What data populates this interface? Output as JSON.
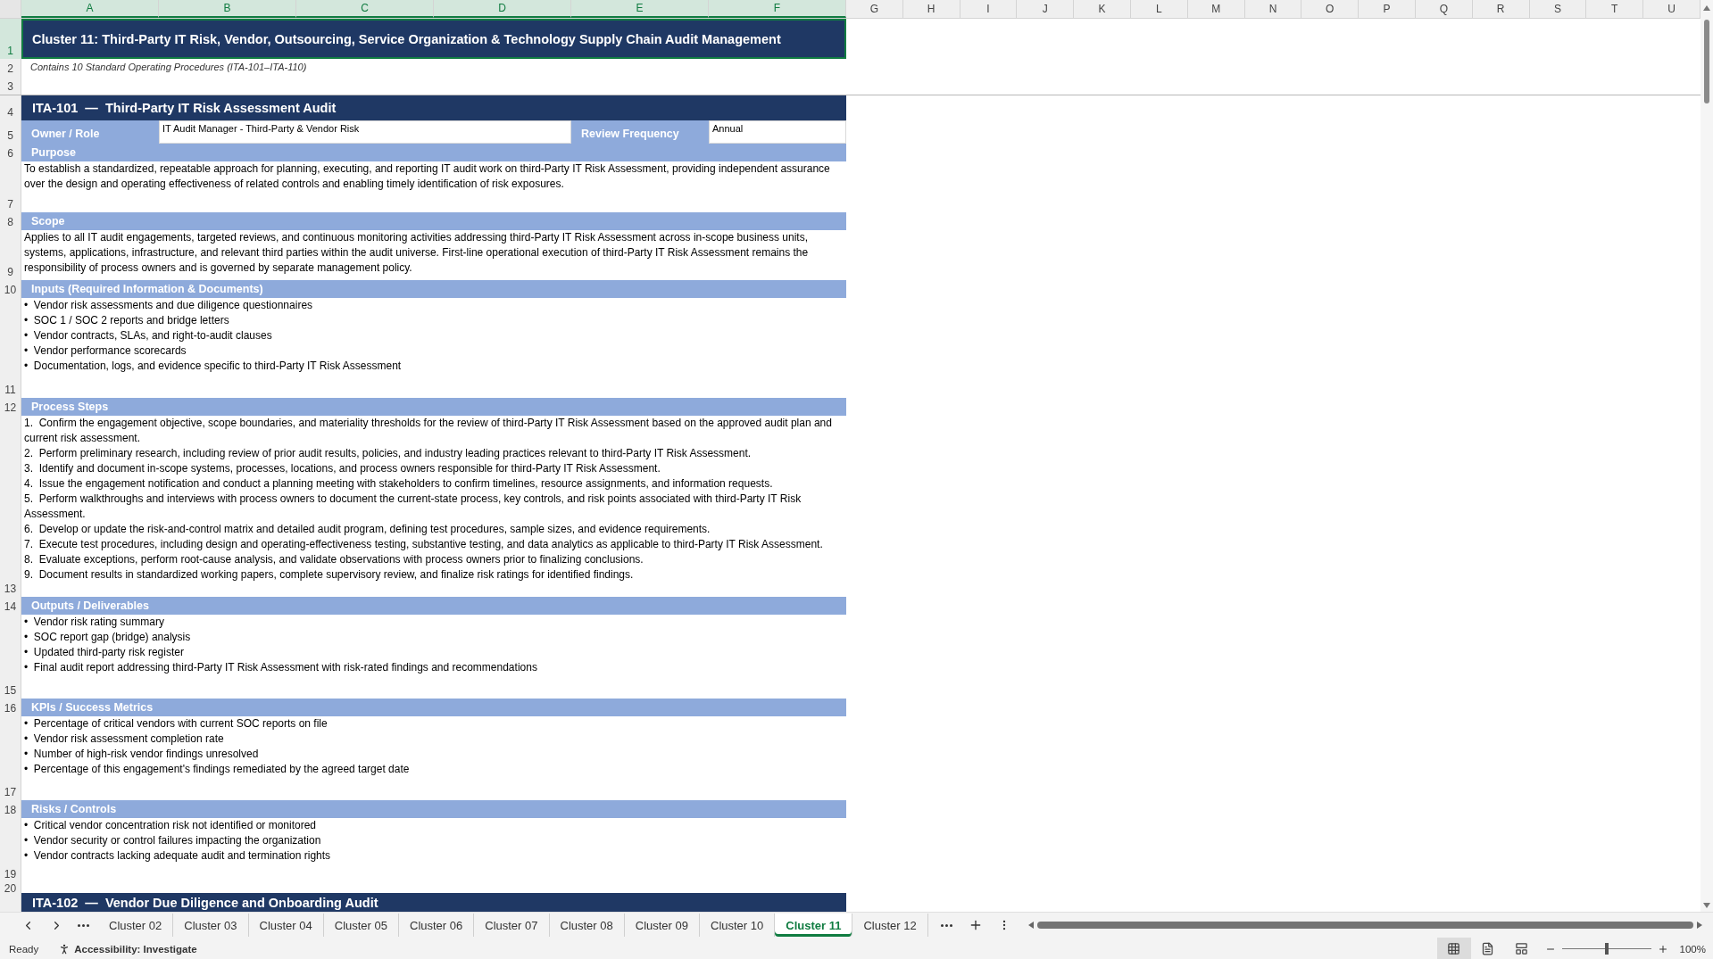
{
  "columns": [
    {
      "label": "A",
      "selected": true
    },
    {
      "label": "B",
      "selected": true
    },
    {
      "label": "C",
      "selected": true
    },
    {
      "label": "D",
      "selected": true
    },
    {
      "label": "E",
      "selected": true
    },
    {
      "label": "F",
      "selected": true
    },
    {
      "label": "G",
      "selected": false
    },
    {
      "label": "H",
      "selected": false
    },
    {
      "label": "I",
      "selected": false
    },
    {
      "label": "J",
      "selected": false
    },
    {
      "label": "K",
      "selected": false
    },
    {
      "label": "L",
      "selected": false
    },
    {
      "label": "M",
      "selected": false
    },
    {
      "label": "N",
      "selected": false
    },
    {
      "label": "O",
      "selected": false
    },
    {
      "label": "P",
      "selected": false
    },
    {
      "label": "Q",
      "selected": false
    },
    {
      "label": "R",
      "selected": false
    },
    {
      "label": "S",
      "selected": false
    },
    {
      "label": "T",
      "selected": false
    },
    {
      "label": "U",
      "selected": false
    }
  ],
  "rows": [
    {
      "number": "1",
      "selected": true,
      "kind": "title",
      "text": "Cluster 11: Third-Party IT Risk, Vendor, Outsourcing, Service Organization & Technology Supply Chain Audit Management"
    },
    {
      "number": "2",
      "selected": false,
      "kind": "note",
      "text": "Contains 10 Standard Operating Procedures (ITA-101–ITA-110)"
    },
    {
      "number": "3",
      "selected": false,
      "kind": "blank"
    },
    {
      "number": "4",
      "selected": false,
      "kind": "sop_header",
      "text": "ITA-101  —  Third-Party IT Risk Assessment Audit"
    },
    {
      "number": "5",
      "selected": false,
      "kind": "owner",
      "owner_label": "Owner / Role",
      "owner": "IT Audit Manager - Third-Party & Vendor Risk",
      "frequency_label": "Review Frequency",
      "frequency": "Annual"
    },
    {
      "number": "6",
      "selected": false,
      "kind": "section",
      "text": "Purpose"
    },
    {
      "number": "7",
      "selected": false,
      "kind": "paragraph",
      "text": "To establish a standardized, repeatable approach for planning, executing, and reporting IT audit work on third-Party IT Risk Assessment, providing independent assurance over the design and operating effectiveness of related controls and enabling timely identification of risk exposures."
    },
    {
      "number": "8",
      "selected": false,
      "kind": "section",
      "text": "Scope"
    },
    {
      "number": "9",
      "selected": false,
      "kind": "paragraph",
      "text": "Applies to all IT audit engagements, targeted reviews, and continuous monitoring activities addressing third-Party IT Risk Assessment across in-scope business units, systems, applications, infrastructure, and relevant third parties within the audit universe. First-line operational execution of third-Party IT Risk Assessment remains the responsibility of process owners and is governed by separate management policy."
    },
    {
      "number": "10",
      "selected": false,
      "kind": "section",
      "text": "Inputs (Required Information & Documents)"
    },
    {
      "number": "11",
      "selected": false,
      "kind": "list",
      "items": [
        "•  Vendor risk assessments and due diligence questionnaires",
        "•  SOC 1 / SOC 2 reports and bridge letters",
        "•  Vendor contracts, SLAs, and right-to-audit clauses",
        "•  Vendor performance scorecards",
        "•  Documentation, logs, and evidence specific to third-Party IT Risk Assessment"
      ]
    },
    {
      "number": "12",
      "selected": false,
      "kind": "section",
      "text": "Process Steps"
    },
    {
      "number": "13",
      "selected": false,
      "kind": "list",
      "items": [
        "1.  Confirm the engagement objective, scope boundaries, and materiality thresholds for the review of third-Party IT Risk Assessment based on the approved audit plan and current risk assessment.",
        "2.  Perform preliminary research, including review of prior audit results, policies, and industry leading practices relevant to third-Party IT Risk Assessment.",
        "3.  Identify and document in-scope systems, processes, locations, and process owners responsible for third-Party IT Risk Assessment.",
        "4.  Issue the engagement notification and conduct a planning meeting with stakeholders to confirm timelines, resource assignments, and information requests.",
        "5.  Perform walkthroughs and interviews with process owners to document the current-state process, key controls, and risk points associated with third-Party IT Risk Assessment.",
        "6.  Develop or update the risk-and-control matrix and detailed audit program, defining test procedures, sample sizes, and evidence requirements.",
        "7.  Execute test procedures, including design and operating-effectiveness testing, substantive testing, and data analytics as applicable to third-Party IT Risk Assessment.",
        "8.  Evaluate exceptions, perform root-cause analysis, and validate observations with process owners prior to finalizing conclusions.",
        "9.  Document results in standardized working papers, complete supervisory review, and finalize risk ratings for identified findings."
      ]
    },
    {
      "number": "14",
      "selected": false,
      "kind": "section",
      "text": "Outputs / Deliverables"
    },
    {
      "number": "15",
      "selected": false,
      "kind": "list",
      "items": [
        "•  Vendor risk rating summary",
        "•  SOC report gap (bridge) analysis",
        "•  Updated third-party risk register",
        "•  Final audit report addressing third-Party IT Risk Assessment with risk-rated findings and recommendations"
      ]
    },
    {
      "number": "16",
      "selected": false,
      "kind": "section",
      "text": "KPIs / Success Metrics"
    },
    {
      "number": "17",
      "selected": false,
      "kind": "list",
      "items": [
        "•  Percentage of critical vendors with current SOC reports on file",
        "•  Vendor risk assessment completion rate",
        "•  Number of high-risk vendor findings unresolved",
        "•  Percentage of this engagement's findings remediated by the agreed target date"
      ]
    },
    {
      "number": "18",
      "selected": false,
      "kind": "section",
      "text": "Risks / Controls"
    },
    {
      "number": "19",
      "selected": false,
      "kind": "list",
      "items": [
        "•  Critical vendor concentration risk not identified or monitored",
        "•  Vendor security or control failures impacting the organization",
        "•  Vendor contracts lacking adequate audit and termination rights"
      ]
    },
    {
      "number": "20",
      "selected": false,
      "kind": "blank"
    },
    {
      "selected": false,
      "kind": "sop_header",
      "text": "ITA-102  —  Vendor Due Diligence and Onboarding Audit"
    }
  ],
  "sheet_tabs": [
    {
      "label": "Cluster 02",
      "selected": false
    },
    {
      "label": "Cluster 03",
      "selected": false
    },
    {
      "label": "Cluster 04",
      "selected": false
    },
    {
      "label": "Cluster 05",
      "selected": false
    },
    {
      "label": "Cluster 06",
      "selected": false
    },
    {
      "label": "Cluster 07",
      "selected": false
    },
    {
      "label": "Cluster 08",
      "selected": false
    },
    {
      "label": "Cluster 09",
      "selected": false
    },
    {
      "label": "Cluster 10",
      "selected": false
    },
    {
      "label": "Cluster 11",
      "selected": true
    },
    {
      "label": "Cluster 12",
      "selected": false
    }
  ],
  "status_bar": {
    "mode": "Ready",
    "accessibility": "Accessibility: Investigate",
    "views": [
      {
        "kind": "normal",
        "selected": true
      },
      {
        "kind": "page_layout",
        "selected": false
      },
      {
        "kind": "page_break",
        "selected": false
      }
    ],
    "zoom": {
      "level": 0.5,
      "reading": "100%"
    }
  }
}
